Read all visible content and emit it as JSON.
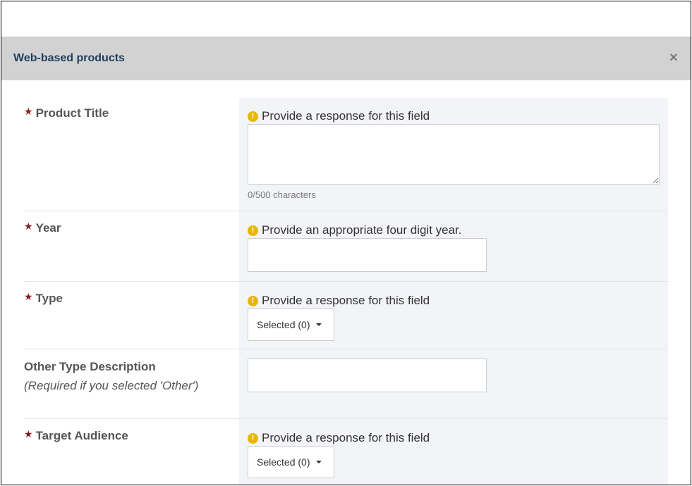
{
  "modal": {
    "title": "Web-based products",
    "close_glyph": "×"
  },
  "fields": {
    "product_title": {
      "label": "Product Title",
      "warning": "Provide a response for this field",
      "value": "",
      "counter": "0/500 characters"
    },
    "year": {
      "label": "Year",
      "warning": "Provide an appropriate four digit year.",
      "value": ""
    },
    "type": {
      "label": "Type",
      "warning": "Provide a response for this field",
      "selected": "Selected (0)"
    },
    "other_type": {
      "label": "Other Type Description",
      "sublabel": "(Required if you selected 'Other')",
      "value": ""
    },
    "target_audience": {
      "label": "Target Audience",
      "warning": "Provide a response for this field",
      "selected": "Selected (0)"
    }
  },
  "icons": {
    "required": "★",
    "warning": "!"
  },
  "colors": {
    "header_bg": "#d2d2d2",
    "title": "#1f3d5c",
    "required_star": "#8b1a1a",
    "warning_icon": "#e8b600"
  }
}
